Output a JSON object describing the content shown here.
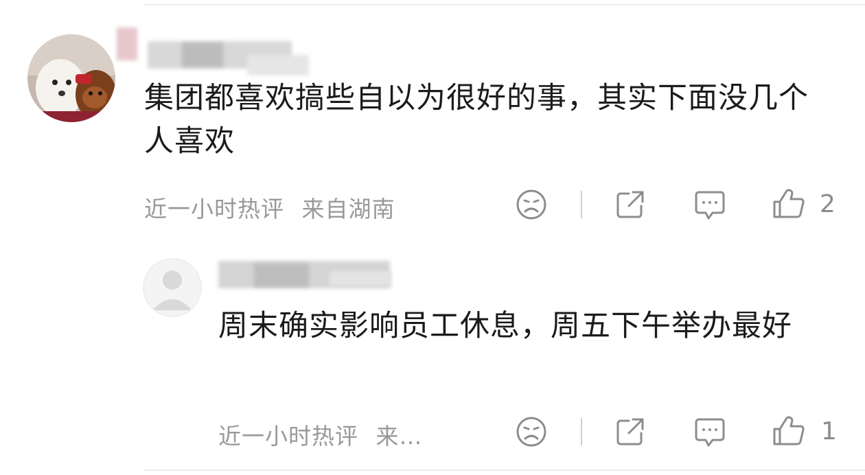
{
  "comments": [
    {
      "text": "集团都喜欢搞些自以为很好的事，其实下面没几个人喜欢",
      "time": "近一小时热评",
      "location": "来自湖南",
      "likes": "2",
      "icons": [
        "sad-face-icon",
        "share-icon",
        "comment-bubble-icon",
        "thumbs-up-icon"
      ]
    }
  ],
  "replies": [
    {
      "text": "周末确实影响员工休息，周五下午举办最好",
      "time": "近一小时热评",
      "location": "来…",
      "likes": "1",
      "icons": [
        "sad-face-icon",
        "share-icon",
        "comment-bubble-icon",
        "thumbs-up-icon"
      ]
    }
  ],
  "colors": {
    "meta": "#999999",
    "icon": "#8c8c8c",
    "text": "#1b1b1b",
    "divider": "#ededed"
  }
}
